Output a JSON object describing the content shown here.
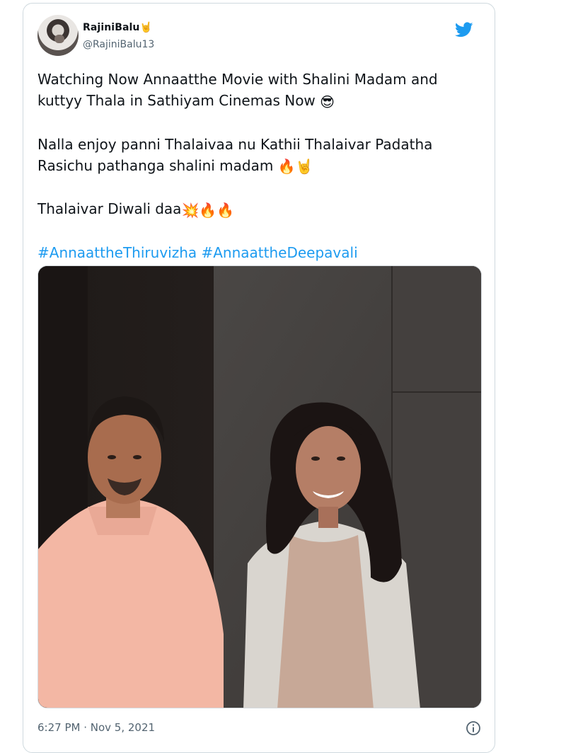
{
  "tweet": {
    "display_name": "RajiniBalu",
    "name_emoji": "🤘",
    "handle": "@RajiniBalu13",
    "paragraphs": [
      "Watching Now Annaatthe Movie with Shalini Madam and\nkuttyy Thala in Sathiyam Cinemas Now",
      "Nalla enjoy panni Thalaivaa nu Kathii Thalaivar Padatha\nRasichu pathanga shalini madam",
      "Thalaivar Diwali daa"
    ],
    "paragraph_emojis": [
      "😎",
      "🔥🤘",
      "💥🔥🔥"
    ],
    "hashtags": "#AnnaattheThiruvizha #AnnaattheDeepavali",
    "timestamp": "6:27 PM · Nov 5, 2021"
  },
  "icons": {
    "brand": "twitter-bird-icon",
    "info": "info-icon"
  },
  "colors": {
    "twitter_blue": "#1d9bf0",
    "text": "#0f1419",
    "muted": "#536471",
    "border": "#cfd9de"
  }
}
